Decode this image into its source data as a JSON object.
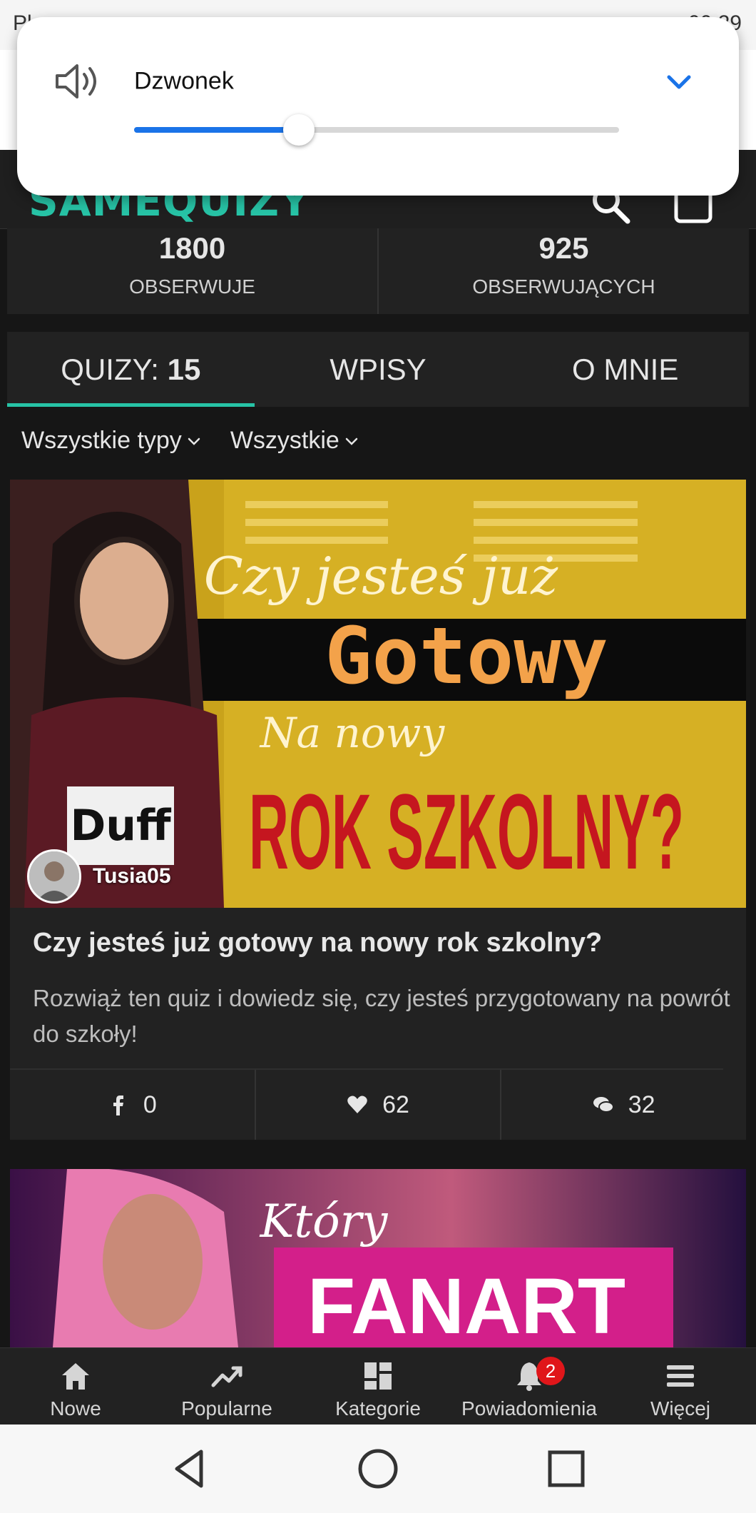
{
  "status_bar": {
    "left": "Pl",
    "right": "00:29"
  },
  "app": {
    "logo_text": "SAMEQUIZY",
    "brand_color": "#27c3a6"
  },
  "volume": {
    "label": "Dzwonek",
    "level": 0.34,
    "accent": "#1a73e8"
  },
  "stats": [
    {
      "number": "1800",
      "label": "OBSERWUJE"
    },
    {
      "number": "925",
      "label": "OBSERWUJĄCYCH"
    }
  ],
  "tabs": [
    {
      "label": "QUIZY:",
      "count": "15",
      "active": true
    },
    {
      "label": "WPISY",
      "active": false
    },
    {
      "label": "O MNIE",
      "active": false
    }
  ],
  "filters": [
    "Wszystkie typy",
    "Wszystkie"
  ],
  "card": {
    "image_text": {
      "line1": "Czy jesteś już",
      "line2": "Gotowy",
      "line3": "Na nowy",
      "line4": "ROK SZKOLNY?",
      "shirt": "Duff"
    },
    "author": "Tusia05",
    "title": "Czy jesteś już gotowy na nowy rok szkolny?",
    "description": "Rozwiąż ten quiz i dowiedz się, czy jesteś przygotowany na powrót do szkoły!",
    "shares": "0",
    "likes": "62",
    "comments": "32"
  },
  "card2": {
    "image_text": {
      "line1": "Który",
      "line2": "FANART"
    }
  },
  "bottom_nav": [
    {
      "label": "Nowe",
      "icon": "home-icon"
    },
    {
      "label": "Popularne",
      "icon": "trending-icon"
    },
    {
      "label": "Kategorie",
      "icon": "grid-icon"
    },
    {
      "label": "Powiadomienia",
      "icon": "bell-icon",
      "badge": "2"
    },
    {
      "label": "Więcej",
      "icon": "menu-icon"
    }
  ]
}
